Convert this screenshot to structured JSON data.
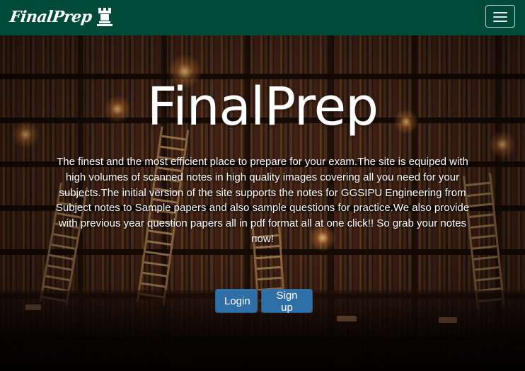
{
  "navbar": {
    "brand": "FinalPrep",
    "brand_icon": "chess-rook-icon",
    "toggle_icon": "hamburger-menu-icon",
    "background_color": "#004a3a"
  },
  "hero": {
    "title": "FinalPrep",
    "description": "The finest and the most efficient place to prepare for your exam.The site is equiped with high volumes of scanned notes in high quality images covering all you need for your subjects.The initial version of the site supports the notes for GGSIPU Engineering from Subject notes to Sample papers and also sample questions for practice.We also provide with previous year question papers all in pdf format all at one click!! So grab your notes now!",
    "login_label": "Login",
    "signup_label": "Sign up",
    "button_color": "#2f6fa8"
  }
}
